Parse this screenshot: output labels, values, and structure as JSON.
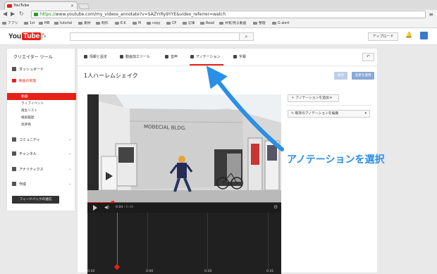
{
  "browser": {
    "tab_title": "YouTube",
    "close_glyph": "×",
    "url_scheme": "https://",
    "url_rest": "www.youtube.com/my_videos_annotate?v=SAZYrRy9YYE&video_referrer=watch",
    "bookmarks": [
      "アプリ",
      "1st",
      "MB",
      "tutorial",
      "素材",
      "制作",
      "E.K",
      "M",
      "copy",
      "CP",
      "記事",
      "Read",
      "共有/見る動画",
      "整理",
      "G alert"
    ]
  },
  "youtube": {
    "logo_you": "You",
    "logo_tube": "Tube",
    "logo_region": "JP",
    "upload_label": "アップロード"
  },
  "sidebar": {
    "title": "クリエイター ツール",
    "dashboard": "ダッシュボード",
    "video_manager": "動画の管理",
    "sub_items": [
      "動画",
      "ライブイベント",
      "再生リスト",
      "検索履歴",
      "高評価"
    ],
    "community": "コミュニティ",
    "channel": "チャンネル",
    "analytics": "アナリティクス",
    "create": "作成",
    "feedback": "フィードバックの送信"
  },
  "editor": {
    "tabs": [
      "情報と設定",
      "動画加工ツール",
      "音声",
      "アノテーション",
      "字幕"
    ],
    "active_tab": "アノテーション",
    "back_glyph": "↶",
    "video_title": "1人ハーレムシェイク",
    "save_label": "保存",
    "publish_label": "変更を適用"
  },
  "player": {
    "current_time": "0:04",
    "duration": "/ 0:30",
    "progress_fraction": 0.13,
    "timeline_labels": [
      "0:10",
      "0:00",
      "0:20",
      "0:31"
    ],
    "sign_text": "MOBECIAL BLDG."
  },
  "annotations": {
    "add_label": "アノテーションを追加",
    "edit_label": "既存のアノテーションを編集"
  },
  "callout": {
    "text": "アノテーションを選択",
    "color": "#2a8fe6"
  },
  "colors": {
    "accent_red": "#e62117",
    "callout_blue": "#2a8fe6"
  }
}
